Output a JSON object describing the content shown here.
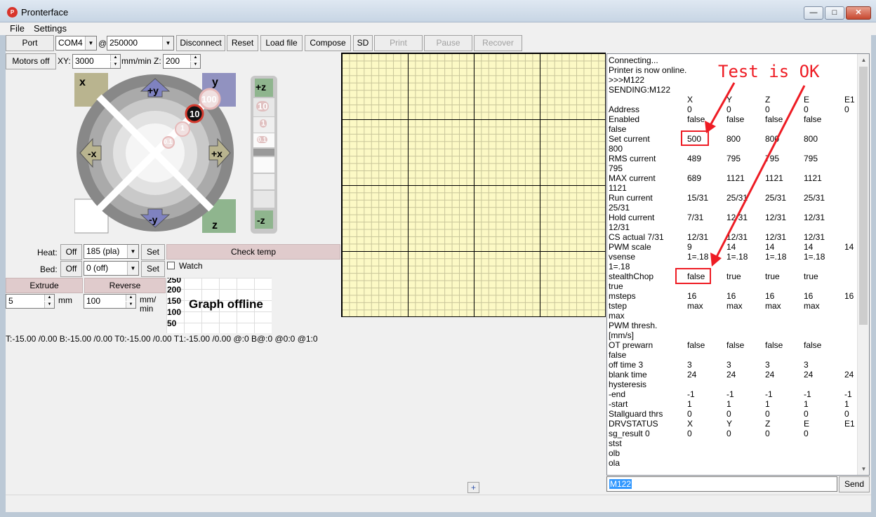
{
  "window": {
    "title": "Pronterface",
    "minimize": "—",
    "maximize": "□",
    "close": "✕"
  },
  "menu": {
    "file": "File",
    "settings": "Settings"
  },
  "toolbar": {
    "port_label": "Port",
    "port_value": "COM4",
    "at": "@",
    "baud_value": "250000",
    "disconnect": "Disconnect",
    "reset": "Reset",
    "load_file": "Load file",
    "compose": "Compose",
    "sd": "SD",
    "print": "Print",
    "pause": "Pause",
    "recover": "Recover"
  },
  "motion": {
    "motors_off": "Motors off",
    "xy_label": "XY:",
    "xy_value": "3000",
    "unit_label": "mm/min Z:",
    "z_value": "200"
  },
  "jog": {
    "home_x": "x",
    "home_y": "y",
    "home_z": "z",
    "plus_y": "+y",
    "minus_y": "-y",
    "plus_x": "+x",
    "minus_x": "-x",
    "plus_z": "+z",
    "minus_z": "-z",
    "step_100": "100",
    "step_10": "10",
    "step_1": "1",
    "step_01": "0.1"
  },
  "temps": {
    "heat_label": "Heat:",
    "heat_off": "Off",
    "heat_value": "185 (pla)",
    "heat_set": "Set",
    "check_temp": "Check temp",
    "bed_label": "Bed:",
    "bed_off": "Off",
    "bed_value": "0 (off)",
    "bed_set": "Set",
    "watch": "Watch"
  },
  "extrude": {
    "extrude": "Extrude",
    "reverse": "Reverse",
    "length": "5",
    "mm": "mm",
    "speed": "100",
    "mm_min_1": "mm/",
    "mm_min_2": "min"
  },
  "graph": {
    "ticks": [
      "250",
      "200",
      "150",
      "100",
      "50"
    ],
    "message": "Graph offline"
  },
  "temp_status": "T:-15.00 /0.00 B:-15.00 /0.00 T0:-15.00 /0.00 T1:-15.00 /0.00 @:0 B@:0 @0:0 @1:0",
  "console": {
    "lines": [
      "Connecting...",
      "Printer is now online.",
      ">>>M122",
      "SENDING:M122"
    ],
    "header": [
      "X",
      "Y",
      "Z",
      "E",
      "E1"
    ],
    "rows": [
      {
        "label": "Address",
        "vals": [
          "0",
          "0",
          "0",
          "0",
          "0"
        ]
      },
      {
        "label": "Enabled",
        "vals": [
          "false",
          "false",
          "false",
          "false",
          ""
        ]
      },
      {
        "label": "false",
        "vals": []
      },
      {
        "label": "Set current",
        "vals": [
          "500",
          "800",
          "800",
          "800",
          ""
        ]
      },
      {
        "label": "800",
        "vals": []
      },
      {
        "label": "RMS current",
        "vals": [
          "489",
          "795",
          "795",
          "795",
          ""
        ]
      },
      {
        "label": "795",
        "vals": []
      },
      {
        "label": "MAX current",
        "vals": [
          "689",
          "1121",
          "1121",
          "1121",
          ""
        ]
      },
      {
        "label": "1121",
        "vals": []
      },
      {
        "label": "Run current",
        "vals": [
          "15/31",
          "25/31",
          "25/31",
          "25/31",
          ""
        ]
      },
      {
        "label": "25/31",
        "vals": []
      },
      {
        "label": "Hold current",
        "vals": [
          "7/31",
          "12/31",
          "12/31",
          "12/31",
          ""
        ]
      },
      {
        "label": "12/31",
        "vals": []
      },
      {
        "label": "CS actual 7/31",
        "vals": [
          "12/31",
          "12/31",
          "12/31",
          "12/31",
          ""
        ]
      },
      {
        "label": "PWM scale",
        "vals": [
          "9",
          "14",
          "14",
          "14",
          "14"
        ]
      },
      {
        "label": "vsense",
        "vals": [
          "1=.18",
          "1=.18",
          "1=.18",
          "1=.18",
          ""
        ]
      },
      {
        "label": "1=.18",
        "vals": []
      },
      {
        "label": "stealthChop",
        "vals": [
          "false",
          "true",
          "true",
          "true",
          ""
        ]
      },
      {
        "label": "true",
        "vals": []
      },
      {
        "label": "msteps",
        "vals": [
          "16",
          "16",
          "16",
          "16",
          "16"
        ]
      },
      {
        "label": "tstep",
        "vals": [
          "max",
          "max",
          "max",
          "max",
          ""
        ]
      },
      {
        "label": "max",
        "vals": []
      },
      {
        "label": "PWM thresh.",
        "vals": []
      },
      {
        "label": "[mm/s]",
        "vals": []
      },
      {
        "label": "OT prewarn",
        "vals": [
          "false",
          "false",
          "false",
          "false",
          ""
        ]
      },
      {
        "label": "false",
        "vals": []
      },
      {
        "label": "off time   3",
        "vals": [
          "3",
          "3",
          "3",
          "3",
          ""
        ]
      },
      {
        "label": "blank time",
        "vals": [
          "24",
          "24",
          "24",
          "24",
          "24"
        ]
      },
      {
        "label": "hysteresis",
        "vals": []
      },
      {
        "label": " -end",
        "vals": [
          "-1",
          "-1",
          "-1",
          "-1",
          "-1"
        ]
      },
      {
        "label": " -start",
        "vals": [
          "1",
          "1",
          "1",
          "1",
          "1"
        ]
      },
      {
        "label": "Stallguard thrs",
        "vals": [
          "0",
          "0",
          "0",
          "0",
          "0"
        ]
      },
      {
        "label": "DRVSTATUS",
        "vals": [
          "X",
          "Y",
          "Z",
          "E",
          "E1"
        ]
      },
      {
        "label": "sg_result  0",
        "vals": [
          "0",
          "0",
          "0",
          "0",
          ""
        ]
      },
      {
        "label": "stst",
        "vals": []
      },
      {
        "label": "olb",
        "vals": []
      },
      {
        "label": "ola",
        "vals": []
      }
    ]
  },
  "command": {
    "value": "M122",
    "send": "Send"
  },
  "plus_button": "+",
  "annotation": {
    "text": "Test is OK",
    "color": "#ee1c24"
  }
}
